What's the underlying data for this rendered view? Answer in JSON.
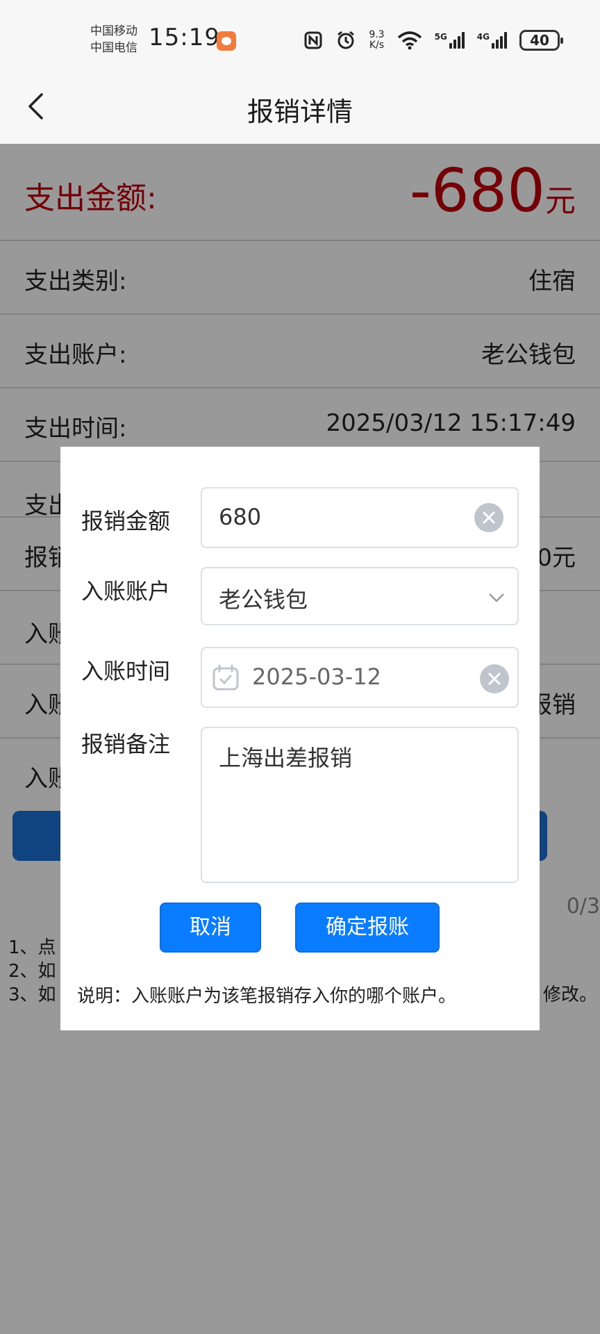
{
  "status_bar": {
    "carrier_1": "中国移动",
    "carrier_2": "中国电信",
    "time": "15:19",
    "net_speed_value": "9.3",
    "net_speed_unit": "K/s",
    "sig1_label": "5G",
    "sig2_label": "4G",
    "battery": "40"
  },
  "nav": {
    "title": "报销详情"
  },
  "detail": {
    "amount_label": "支出金额:",
    "amount_value": "-680",
    "amount_unit": "元",
    "category_label": "支出类别:",
    "category_value": "住宿",
    "account_label": "支出账户:",
    "account_value": "老公钱包",
    "time_label": "支出时间:",
    "time_value": "2025/03/12 15:17:49",
    "row4_label": "支出",
    "row5_label": "报销",
    "row5_value": "0元",
    "row6_label": "入账",
    "row7_label": "入账",
    "row7_value": "报销",
    "row8_label": "入账",
    "counter": "0/3",
    "note_1": "1、点",
    "note_2": "2、如",
    "note_3": "3、如",
    "note_3_tail": "修改。"
  },
  "modal": {
    "amount_label": "报销金额",
    "amount_value": "680",
    "account_label": "入账账户",
    "account_value": "老公钱包",
    "time_label": "入账时间",
    "time_value": "2025-03-12",
    "remark_label": "报销备注",
    "remark_value": "上海出差报销",
    "cancel_label": "取消",
    "confirm_label": "确定报账",
    "explanation": "说明：入账账户为该笔报销存入你的哪个账户。"
  },
  "colors": {
    "accent_red": "#c0000a",
    "button_blue": "#0a7cff",
    "bar_blue": "#1a72d6"
  }
}
